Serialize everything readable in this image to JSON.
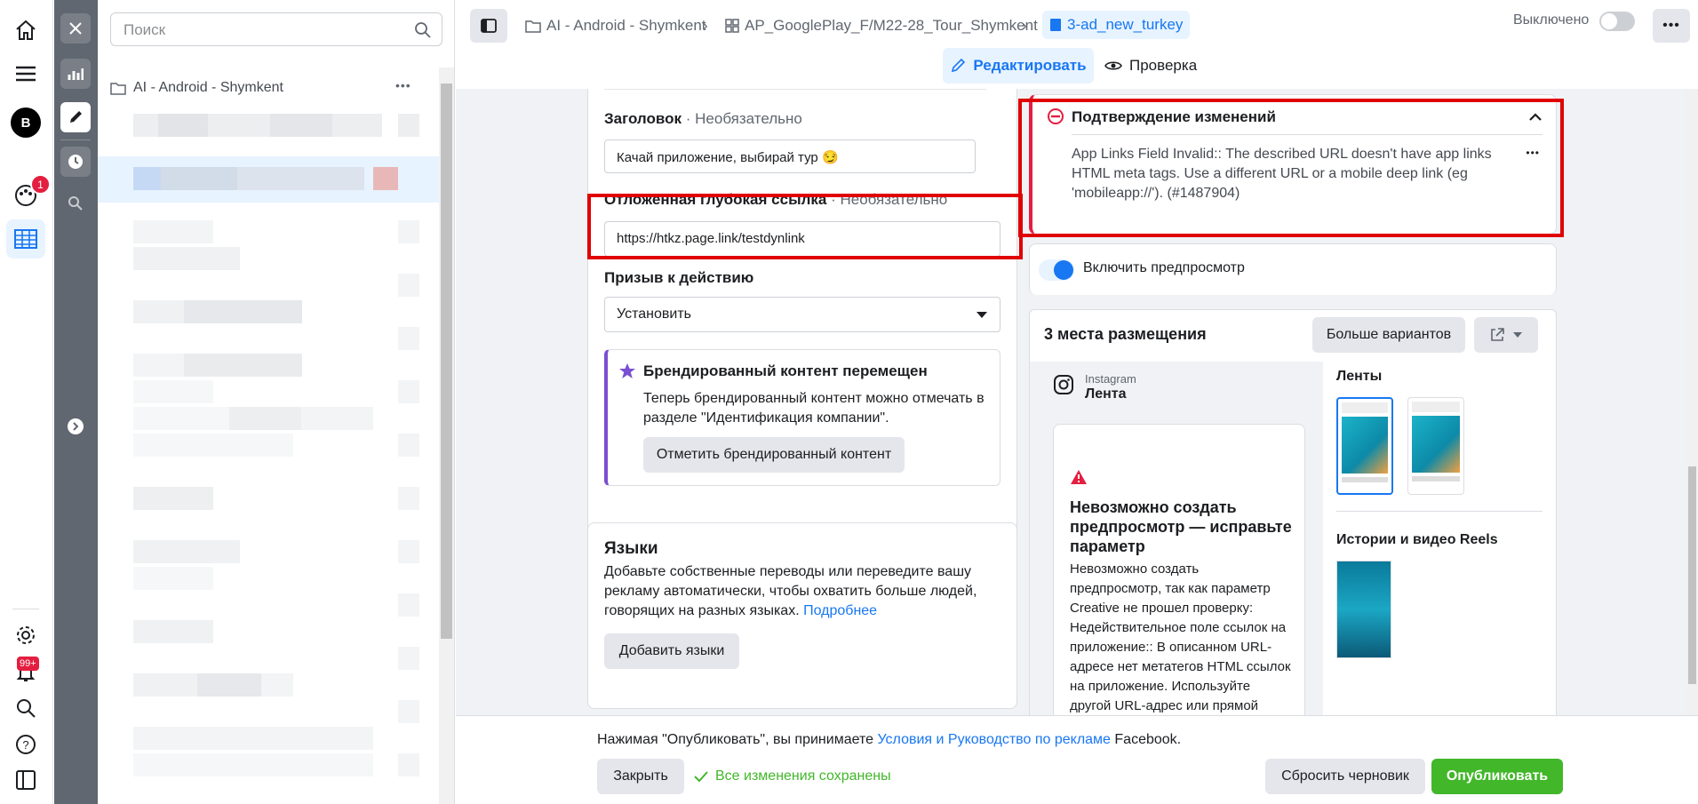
{
  "tree": {
    "search_placeholder": "Поиск",
    "campaign": "AI - Android - Shymkent",
    "more": "•••"
  },
  "rail": {
    "avatar_letter": "B",
    "badge_count": "1",
    "notif_count": "99+"
  },
  "breadcrumb": {
    "item1": "AI - Android - Shymkent",
    "item2": "AP_GooglePlay_F/M22-28_Tour_Shymkent",
    "item3": "3-ad_new_turkey"
  },
  "toggle_status": "Выключено",
  "tabs": {
    "edit": "Редактировать",
    "review": "Проверка"
  },
  "form": {
    "headline_label": "Заголовок",
    "optional": "· Необязательно",
    "headline_value": "Качай приложение, выбирай тур 😏",
    "deeplink_label": "Отложенная глубокая ссылка",
    "deeplink_value": "https://htkz.page.link/testdynlink",
    "cta_label": "Призыв к действию",
    "cta_value": "Установить",
    "branded_title": "Брендированный контент перемещен",
    "branded_text": "Теперь брендированный контент можно отмечать в разделе \"Идентификация компании\".",
    "branded_button": "Отметить брендированный контент",
    "languages_title": "Языки",
    "languages_text": "Добавьте собственные переводы или переведите вашу рекламу автоматически, чтобы охватить больше людей, говорящих на разных языках.",
    "languages_link": "Подробнее",
    "languages_button": "Добавить языки"
  },
  "confirm": {
    "title": "Подтверждение изменений",
    "message": "App Links Field Invalid:: The described URL doesn't have app links HTML meta tags. Use a different URL or a mobile deep link (eg 'mobileapp://'). (#1487904)"
  },
  "preview": {
    "toggle_label": "Включить предпросмотр",
    "placements_title": "3 места размещения",
    "more_variants": "Больше вариантов",
    "platform": "Instagram",
    "placement": "Лента",
    "error_title": "Невозможно создать предпросмотр — исправьте параметр",
    "error_text": "Невозможно создать предпросмотр, так как параметр Creative не прошел проверку: Недействительное поле ссылок на приложение:: В описанном URL-адресе нет метатегов HTML ссылок на приложение. Используйте другой URL-адрес или прямой диплинк (например",
    "feeds_title": "Ленты",
    "stories_title": "Истории и видео Reels"
  },
  "footer": {
    "terms_prefix": "Нажимая \"Опубликовать\", вы принимаете",
    "terms_link": "Условия и Руководство по рекламе",
    "terms_suffix": "Facebook.",
    "close": "Закрыть",
    "saved": "Все изменения сохранены",
    "reset": "Сбросить черновик",
    "publish": "Опубликовать"
  },
  "colors": {
    "accent": "#1877f2",
    "publish": "#42b72a",
    "error": "#e00000"
  }
}
